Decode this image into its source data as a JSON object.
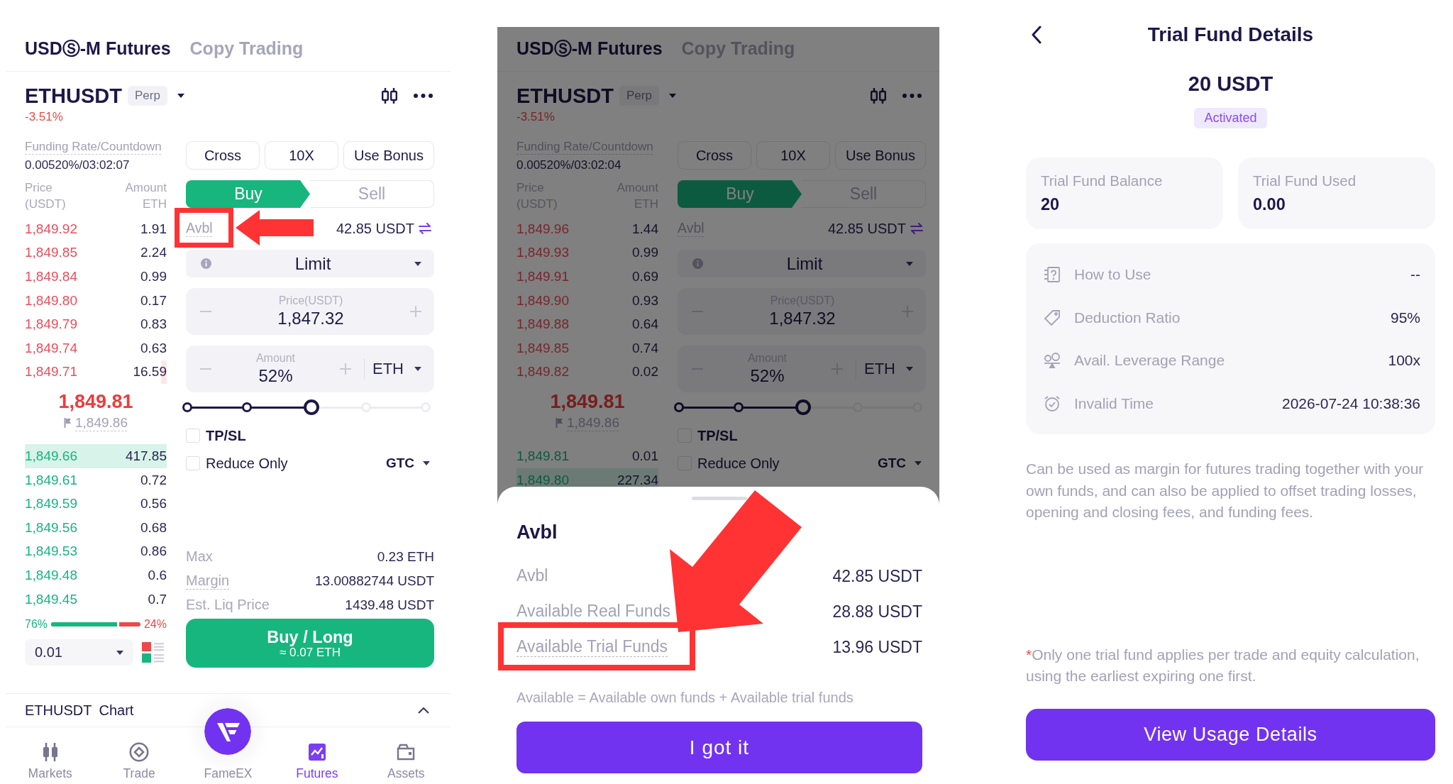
{
  "screens": [
    {
      "tabs": [
        {
          "label": "USDⓈ-M Futures",
          "selected": true
        },
        {
          "label": "Copy Trading",
          "selected": false
        }
      ],
      "symbol": {
        "name": "ETHUSDT",
        "badge": "Perp",
        "change": "-3.51%"
      },
      "funding": {
        "label": "Funding Rate/Countdown",
        "value": "0.00520%/03:02:07"
      },
      "book_columns": [
        {
          "label": "Price",
          "unit": "(USDT)"
        },
        {
          "label": "Amount",
          "unit": "ETH"
        }
      ],
      "asks": [
        {
          "price": "1,849.92",
          "amount": "1.91"
        },
        {
          "price": "1,849.85",
          "amount": "2.24"
        },
        {
          "price": "1,849.84",
          "amount": "0.99"
        },
        {
          "price": "1,849.80",
          "amount": "0.17"
        },
        {
          "price": "1,849.79",
          "amount": "0.83"
        },
        {
          "price": "1,849.74",
          "amount": "0.63"
        },
        {
          "price": "1,849.71",
          "amount": "16.59",
          "level": 0.04
        }
      ],
      "last_price": "1,849.81",
      "mark_price": "1,849.86",
      "bids": [
        {
          "price": "1,849.66",
          "amount": "417.85",
          "level": 1
        },
        {
          "price": "1,849.61",
          "amount": "0.72"
        },
        {
          "price": "1,849.59",
          "amount": "0.56"
        },
        {
          "price": "1,849.56",
          "amount": "0.68"
        },
        {
          "price": "1,849.53",
          "amount": "0.86"
        },
        {
          "price": "1,849.48",
          "amount": "0.6"
        },
        {
          "price": "1,849.45",
          "amount": "0.7"
        }
      ],
      "ratio": {
        "buy": "76%",
        "sell": "24%",
        "level": 0.76
      },
      "depth_step": "0.01",
      "margin_buttons": [
        "Cross",
        "10X",
        "Use Bonus"
      ],
      "sides": [
        {
          "label": "Buy",
          "selected": true
        },
        {
          "label": "Sell",
          "selected": false
        }
      ],
      "available": {
        "label": "Avbl",
        "value": "42.85 USDT",
        "highlighted": true
      },
      "order_type": "Limit",
      "price_field": {
        "label": "Price(USDT)",
        "value": "1,847.32"
      },
      "amount_field": {
        "label": "Amount",
        "value": "52%",
        "unit": "ETH"
      },
      "slider": {
        "level": 0.52
      },
      "options": [
        {
          "label": "TP/SL",
          "checked": false
        },
        {
          "label": "Reduce Only",
          "checked": false
        }
      ],
      "time_in_force": "GTC",
      "summary": [
        {
          "label": "Max",
          "value": "0.23 ETH",
          "underlined": false
        },
        {
          "label": "Margin",
          "value": "13.00882744 USDT",
          "underlined": true
        },
        {
          "label": "Est. Liq Price",
          "value": "1439.48 USDT",
          "underlined": false
        }
      ],
      "submit": {
        "label": "Buy / Long",
        "note": "≈ 0.07 ETH"
      },
      "chart_bar": {
        "symbol": "ETHUSDT",
        "label": "Chart"
      },
      "nav": [
        {
          "kind": "markets",
          "label": "Markets",
          "selected": false
        },
        {
          "kind": "trade",
          "label": "Trade",
          "selected": false
        },
        {
          "kind": "logo",
          "label": "FameEX",
          "selected": false
        },
        {
          "kind": "futures",
          "label": "Futures",
          "selected": true
        },
        {
          "kind": "assets",
          "label": "Assets",
          "selected": false
        }
      ]
    },
    {
      "tabs": [
        {
          "label": "USDⓈ-M Futures",
          "selected": true
        },
        {
          "label": "Copy Trading",
          "selected": false
        }
      ],
      "symbol": {
        "name": "ETHUSDT",
        "badge": "Perp",
        "change": "-3.51%"
      },
      "funding": {
        "label": "Funding Rate/Countdown",
        "value": "0.00520%/03:02:04"
      },
      "book_columns": [
        {
          "label": "Price",
          "unit": "(USDT)"
        },
        {
          "label": "Amount",
          "unit": "ETH"
        }
      ],
      "asks": [
        {
          "price": "1,849.96",
          "amount": "1.44"
        },
        {
          "price": "1,849.93",
          "amount": "0.99"
        },
        {
          "price": "1,849.91",
          "amount": "0.69"
        },
        {
          "price": "1,849.90",
          "amount": "0.93"
        },
        {
          "price": "1,849.88",
          "amount": "0.64"
        },
        {
          "price": "1,849.85",
          "amount": "0.74"
        },
        {
          "price": "1,849.82",
          "amount": "0.02"
        }
      ],
      "last_price": "1,849.81",
      "mark_price": "1,849.86",
      "bids": [
        {
          "price": "1,849.81",
          "amount": "0.01"
        },
        {
          "price": "1,849.80",
          "amount": "227.34",
          "level": 1
        }
      ],
      "margin_buttons": [
        "Cross",
        "10X",
        "Use Bonus"
      ],
      "sides": [
        {
          "label": "Buy",
          "selected": true
        },
        {
          "label": "Sell",
          "selected": false
        }
      ],
      "available": {
        "label": "Avbl",
        "value": "42.85 USDT",
        "highlighted": false
      },
      "order_type": "Limit",
      "price_field": {
        "label": "Price(USDT)",
        "value": "1,847.32"
      },
      "amount_field": {
        "label": "Amount",
        "value": "52%",
        "unit": "ETH"
      },
      "slider": {
        "level": 0.52
      },
      "options": [
        {
          "label": "TP/SL",
          "checked": false
        },
        {
          "label": "Reduce Only",
          "checked": false
        }
      ],
      "time_in_force": "GTC",
      "sheet": {
        "title": "Avbl",
        "rows": [
          {
            "label": "Avbl",
            "value": "42.85 USDT",
            "underlined": false,
            "highlighted": false
          },
          {
            "label": "Available Real Funds",
            "value": "28.88 USDT",
            "underlined": false,
            "highlighted": false
          },
          {
            "label": "Available Trial Funds",
            "value": "13.96 USDT",
            "underlined": true,
            "highlighted": true
          }
        ],
        "note": "Available = Available own funds + Available trial funds",
        "button": "I got it"
      }
    }
  ],
  "details": {
    "title": "Trial Fund Details",
    "amount": "20 USDT",
    "status": "Activated",
    "stats": [
      {
        "label": "Trial Fund Balance",
        "value": "20"
      },
      {
        "label": "Trial Fund Used",
        "value": "0.00"
      }
    ],
    "rows": [
      {
        "kind": "help",
        "label": "How to Use",
        "value": "--"
      },
      {
        "kind": "tag",
        "label": "Deduction Ratio",
        "value": "95%"
      },
      {
        "kind": "leverage",
        "label": "Avail. Leverage Range",
        "value": "100x"
      },
      {
        "kind": "clock",
        "label": "Invalid Time",
        "value": "2026-07-24 10:38:36"
      }
    ],
    "description": "Can be used as margin for futures trading together with your own funds, and can also be applied to offset trading losses, opening and closing fees, and funding fees.",
    "footnote": {
      "mark": "*",
      "text": "Only one trial fund applies per trade and equity calculation, using the earliest expiring one first."
    },
    "button": "View Usage Details"
  }
}
